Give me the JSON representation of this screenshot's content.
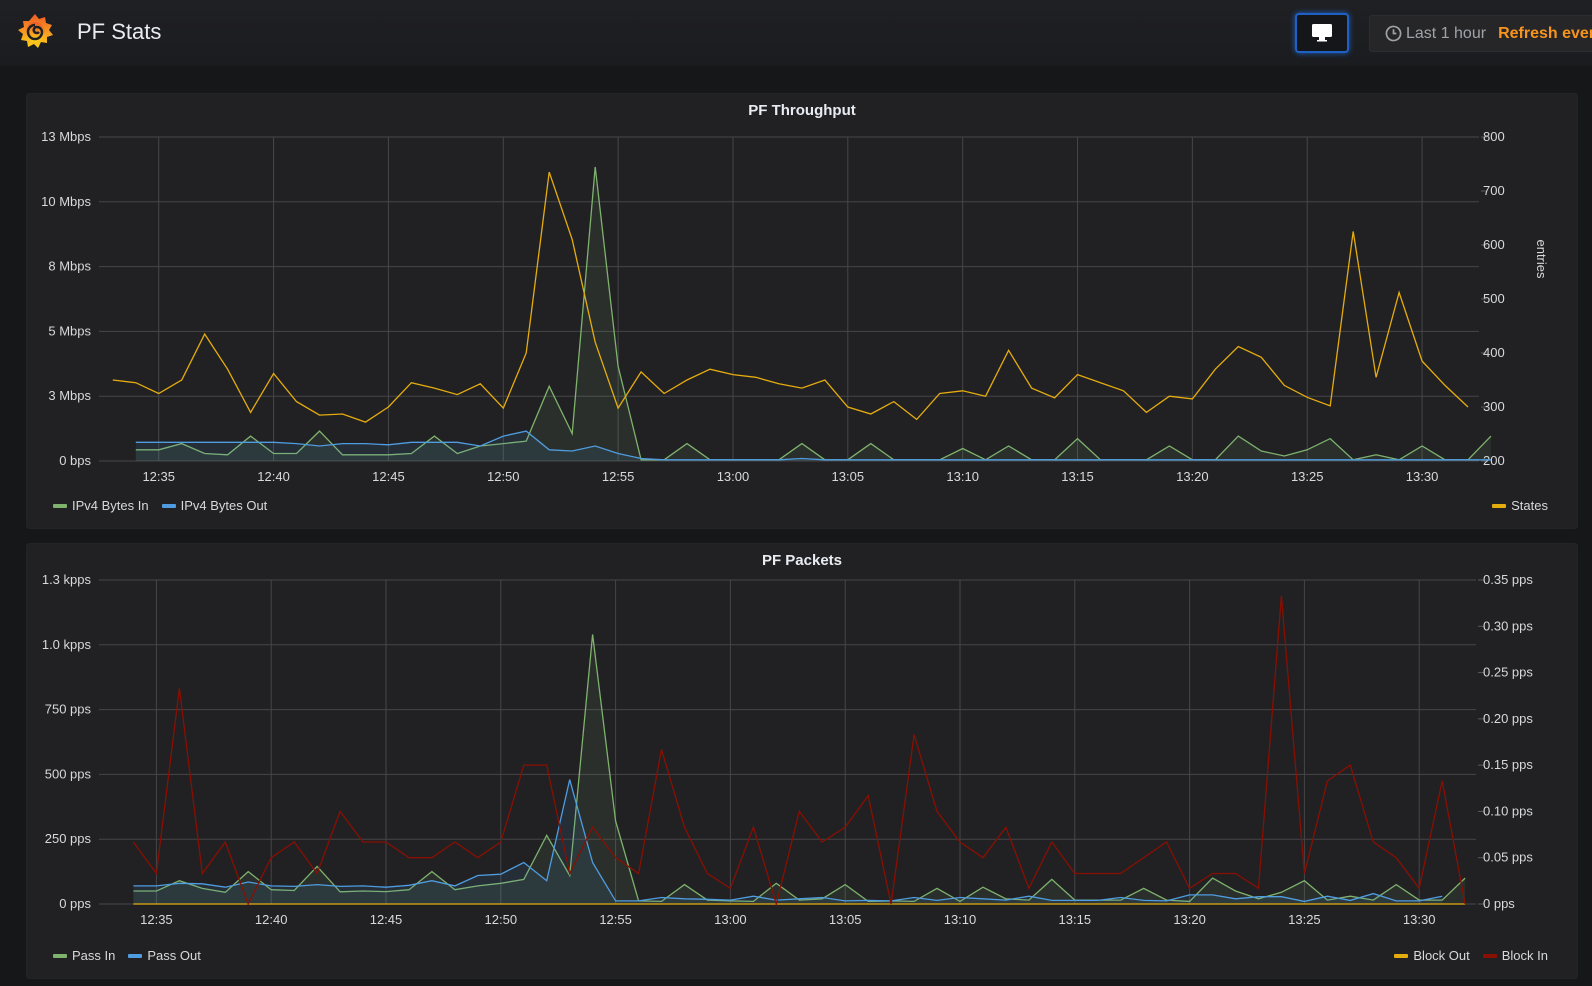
{
  "header": {
    "title": "PF Stats",
    "logo_icon": "grafana-logo-icon",
    "tv_mode_icon": "monitor-icon",
    "time_range": "Last 1 hour",
    "refresh_label": "Refresh every",
    "clock_icon": "clock-icon"
  },
  "colors": {
    "green": "#7eb26d",
    "blue": "#4f9ce0",
    "yellow": "#e5ac0e",
    "red": "#890f02",
    "accent_blue": "#1f60c4",
    "accent_orange": "#f7941d"
  },
  "chart_data": [
    {
      "type": "line",
      "title": "PF Throughput",
      "x_start": "12:33",
      "x_step_minutes": 1,
      "xticks": [
        "12:35",
        "12:40",
        "12:45",
        "12:50",
        "12:55",
        "13:00",
        "13:05",
        "13:10",
        "13:15",
        "13:20",
        "13:25",
        "13:30"
      ],
      "left_axis": {
        "label": "",
        "ticks": [
          "0 bps",
          "3 Mbps",
          "5 Mbps",
          "8 Mbps",
          "10 Mbps",
          "13 Mbps"
        ],
        "range_mbps": [
          0,
          13
        ]
      },
      "right_axis": {
        "label": "entries",
        "ticks": [
          "200",
          "300",
          "400",
          "500",
          "600",
          "700",
          "800"
        ],
        "range": [
          200,
          800
        ]
      },
      "grid": true,
      "series": [
        {
          "name": "IPv4 Bytes In",
          "axis": "left",
          "color": "#7eb26d",
          "fill": true,
          "start_index": 1,
          "values": [
            0.45,
            0.45,
            0.7,
            0.3,
            0.25,
            1.0,
            0.3,
            0.3,
            1.2,
            0.25,
            0.25,
            0.25,
            0.3,
            1.0,
            0.3,
            0.6,
            0.7,
            0.8,
            3.0,
            1.1,
            11.8,
            3.8,
            0.05,
            0.05,
            0.7,
            0.05,
            0.05,
            0.05,
            0.05,
            0.7,
            0.05,
            0.05,
            0.7,
            0.05,
            0.05,
            0.05,
            0.5,
            0.05,
            0.6,
            0.05,
            0.05,
            0.9,
            0.05,
            0.05,
            0.05,
            0.6,
            0.05,
            0.05,
            1.0,
            0.4,
            0.2,
            0.45,
            0.9,
            0.05,
            0.25,
            0.05,
            0.6,
            0.05,
            0.05,
            1.0
          ]
        },
        {
          "name": "IPv4 Bytes Out",
          "axis": "left",
          "color": "#4f9ce0",
          "fill": true,
          "start_index": 1,
          "values": [
            0.75,
            0.75,
            0.75,
            0.75,
            0.75,
            0.75,
            0.75,
            0.7,
            0.6,
            0.7,
            0.7,
            0.65,
            0.75,
            0.75,
            0.75,
            0.6,
            1.0,
            1.2,
            0.45,
            0.4,
            0.6,
            0.3,
            0.1,
            0.05,
            0.05,
            0.05,
            0.05,
            0.05,
            0.05,
            0.1,
            0.05,
            0.05,
            0.05,
            0.05,
            0.05,
            0.05,
            0.05,
            0.05,
            0.05,
            0.05,
            0.05,
            0.05,
            0.05,
            0.05,
            0.05,
            0.05,
            0.05,
            0.05,
            0.05,
            0.05,
            0.05,
            0.05,
            0.05,
            0.05,
            0.05,
            0.05,
            0.05,
            0.05,
            0.05,
            0.05
          ]
        },
        {
          "name": "States",
          "axis": "right",
          "color": "#e5ac0e",
          "fill": false,
          "start_index": 0,
          "values": [
            350,
            345,
            325,
            350,
            435,
            370,
            290,
            362,
            310,
            285,
            287,
            272,
            300,
            345,
            335,
            323,
            343,
            298,
            400,
            735,
            610,
            420,
            298,
            365,
            325,
            350,
            370,
            360,
            355,
            343,
            335,
            350,
            300,
            287,
            310,
            277,
            325,
            330,
            320,
            405,
            335,
            317,
            360,
            345,
            330,
            290,
            320,
            315,
            370,
            412,
            392,
            340,
            318,
            302,
            625,
            355,
            512,
            385,
            340,
            300
          ]
        }
      ],
      "legend_left": [
        "IPv4 Bytes In",
        "IPv4 Bytes Out"
      ],
      "legend_right": [
        "States"
      ]
    },
    {
      "type": "line",
      "title": "PF Packets",
      "x_start": "12:33",
      "x_step_minutes": 1,
      "xticks": [
        "12:35",
        "12:40",
        "12:45",
        "12:50",
        "12:55",
        "13:00",
        "13:05",
        "13:10",
        "13:15",
        "13:20",
        "13:25",
        "13:30"
      ],
      "left_axis": {
        "label": "",
        "ticks": [
          "0 pps",
          "250 pps",
          "500 pps",
          "750 pps",
          "1.0 kpps",
          "1.3 kpps"
        ],
        "range_pps": [
          0,
          1250
        ]
      },
      "right_axis": {
        "label": "",
        "ticks": [
          "0 pps",
          "0.05 pps",
          "0.10 pps",
          "0.15 pps",
          "0.20 pps",
          "0.25 pps",
          "0.30 pps",
          "0.35 pps"
        ],
        "range": [
          0,
          0.35
        ]
      },
      "grid": true,
      "series": [
        {
          "name": "Pass In",
          "axis": "left",
          "color": "#7eb26d",
          "fill": true,
          "start_index": 1,
          "values": [
            50,
            50,
            90,
            60,
            45,
            125,
            55,
            52,
            145,
            47,
            50,
            48,
            55,
            125,
            55,
            70,
            80,
            95,
            265,
            110,
            1040,
            320,
            12,
            10,
            75,
            15,
            12,
            10,
            80,
            15,
            20,
            75,
            10,
            12,
            10,
            60,
            10,
            65,
            20,
            15,
            95,
            15,
            15,
            15,
            60,
            15,
            10,
            100,
            50,
            20,
            45,
            90,
            15,
            30,
            15,
            75,
            15,
            15,
            100
          ]
        },
        {
          "name": "Pass Out",
          "axis": "left",
          "color": "#4f9ce0",
          "fill": true,
          "start_index": 1,
          "values": [
            70,
            70,
            80,
            78,
            65,
            85,
            70,
            68,
            75,
            68,
            70,
            65,
            72,
            90,
            70,
            110,
            115,
            160,
            90,
            480,
            160,
            12,
            12,
            25,
            20,
            18,
            15,
            30,
            15,
            20,
            25,
            12,
            14,
            12,
            25,
            14,
            25,
            20,
            15,
            30,
            14,
            14,
            14,
            25,
            14,
            12,
            35,
            35,
            20,
            28,
            28,
            10,
            30,
            14,
            40,
            12,
            12,
            30
          ]
        },
        {
          "name": "Block Out",
          "axis": "right",
          "color": "#e5ac0e",
          "fill": false,
          "start_index": 1,
          "values": [
            0,
            0,
            0,
            0,
            0,
            0,
            0,
            0,
            0,
            0,
            0,
            0,
            0,
            0,
            0,
            0,
            0,
            0,
            0,
            0,
            0,
            0,
            0,
            0,
            0,
            0,
            0,
            0,
            0,
            0,
            0,
            0,
            0,
            0,
            0,
            0,
            0,
            0,
            0,
            0,
            0,
            0,
            0,
            0,
            0,
            0,
            0,
            0,
            0,
            0,
            0,
            0,
            0,
            0,
            0,
            0,
            0,
            0,
            0
          ]
        },
        {
          "name": "Block In",
          "axis": "right",
          "color": "#890f02",
          "fill": false,
          "start_index": 1,
          "values": [
            0.067,
            0.033,
            0.233,
            0.033,
            0.067,
            0.0,
            0.05,
            0.067,
            0.033,
            0.1,
            0.067,
            0.067,
            0.05,
            0.05,
            0.067,
            0.05,
            0.067,
            0.15,
            0.15,
            0.033,
            0.083,
            0.05,
            0.033,
            0.167,
            0.083,
            0.033,
            0.017,
            0.083,
            0.0,
            0.1,
            0.067,
            0.083,
            0.117,
            0.0,
            0.183,
            0.1,
            0.067,
            0.05,
            0.083,
            0.017,
            0.067,
            0.033,
            0.033,
            0.033,
            0.05,
            0.067,
            0.017,
            0.033,
            0.033,
            0.017,
            0.333,
            0.033,
            0.133,
            0.15,
            0.067,
            0.05,
            0.017,
            0.133,
            0.0
          ]
        }
      ],
      "legend_left": [
        "Pass In",
        "Pass Out"
      ],
      "legend_right": [
        "Block Out",
        "Block In"
      ]
    }
  ]
}
